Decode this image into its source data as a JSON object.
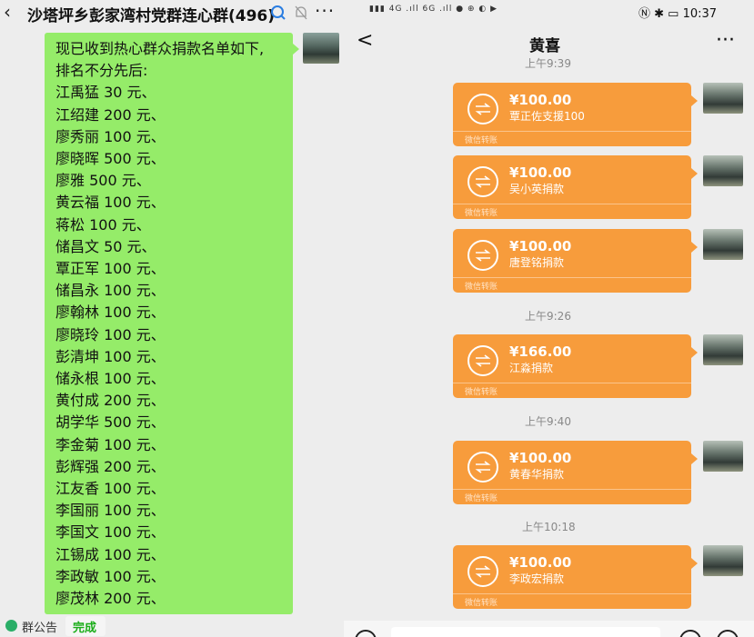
{
  "left": {
    "title": "沙塔坪乡彭家湾村党群连心群(496)",
    "message_lines": [
      "现已收到热心群众捐款名单如下,",
      "排名不分先后:",
      "江禹猛 30 元、",
      "江绍建 200 元、",
      "廖秀丽 100 元、",
      "廖晓晖 500 元、",
      "廖雅 500 元、",
      "黄云福 100 元、",
      "蒋松 100 元、",
      "储昌文 50 元、",
      "覃正军 100 元、",
      "储昌永 100 元、",
      "廖翰林 100 元、",
      "廖晓玲 100 元、",
      "彭清坤 100 元、",
      "储永根 100 元、",
      "黄付成 200 元、",
      "胡学华 500 元、",
      "李金菊 100 元、",
      "彭辉强 200 元、",
      "江友香 100 元、",
      "李国丽 100 元、",
      "李国文 100 元、",
      "江锡成 100 元、",
      "李政敏 100 元、",
      "廖茂林 200 元、"
    ],
    "notice_label": "群公告",
    "done_label": "完成"
  },
  "right": {
    "status_left": "▮▮▮ 4G .ıll  6G .ıll  ● ⊕ ◐ ▶",
    "status_right": "Ⓝ ✱ ▭ 10:37",
    "contact_name": "黄喜",
    "timestamps": [
      "上午9:39",
      "上午9:26",
      "上午9:40",
      "上午10:18"
    ],
    "transfers": [
      {
        "amount": "¥100.00",
        "memo": "覃正佐支援100",
        "source": "微信转账"
      },
      {
        "amount": "¥100.00",
        "memo": "吴小英捐款",
        "source": "微信转账"
      },
      {
        "amount": "¥100.00",
        "memo": "唐登铭捐款",
        "source": "微信转账"
      },
      {
        "amount": "¥166.00",
        "memo": "江淼捐款",
        "source": "微信转账"
      },
      {
        "amount": "¥100.00",
        "memo": "黄春华捐款",
        "source": "微信转账"
      },
      {
        "amount": "¥100.00",
        "memo": "李政宏捐款",
        "source": "微信转账"
      }
    ]
  },
  "colors": {
    "bubble_green": "#95ec69",
    "transfer_orange": "#f79c3c",
    "background": "#ededed"
  }
}
